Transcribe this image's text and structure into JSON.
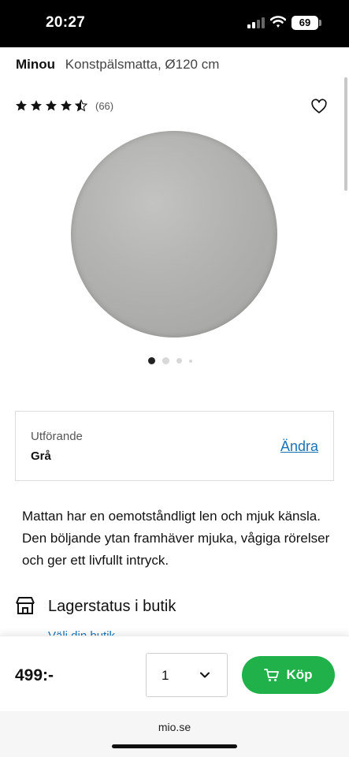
{
  "status_bar": {
    "time": "20:27",
    "battery": "69"
  },
  "product": {
    "brand": "Minou",
    "name": "Konstpälsmatta, Ø120 cm",
    "rating_value": 4.5,
    "rating_count": "(66)",
    "image_icon": "round-gray-rug",
    "carousel_dot_count": 4,
    "carousel_active_index": 0
  },
  "variant": {
    "label": "Utförande",
    "value": "Grå",
    "change_link": "Ändra"
  },
  "description": "Mattan har en oemotståndligt len och mjuk känsla. Den böljande ytan framhäver mjuka, vågiga rörelser och ger ett livfullt intryck.",
  "stock": {
    "title": "Lagerstatus i butik",
    "choose_store": "Välj din butik",
    "icon": "store-icon"
  },
  "buy_bar": {
    "price": "499:-",
    "quantity": "1",
    "buy_label": "Köp"
  },
  "browser": {
    "url": "mio.se"
  },
  "colors": {
    "accent_green": "#21b14a",
    "link_blue": "#1a73b8",
    "rug_gray": "#b4b4b2"
  }
}
